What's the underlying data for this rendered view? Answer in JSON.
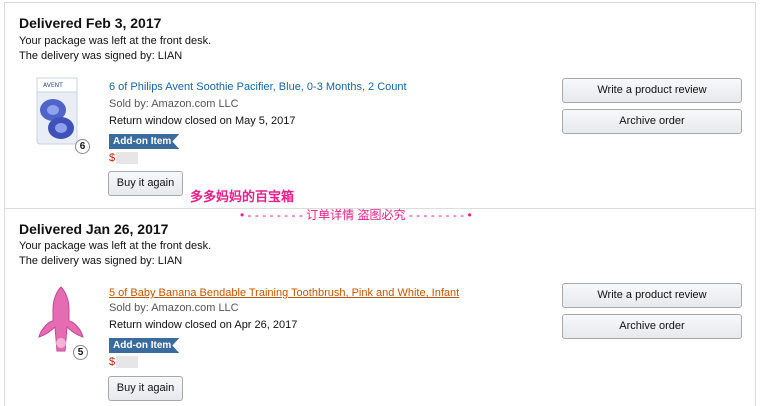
{
  "orders": [
    {
      "status_title": "Delivered Feb 3, 2017",
      "note_left": "Your package was left at the front desk.",
      "note_signed": "The delivery was signed by: LIAN",
      "item": {
        "title": "6 of Philips Avent Soothie Pacifier, Blue, 0-3 Months, 2 Count",
        "sold_by": "Sold by: Amazon.com LLC",
        "return_window": "Return window closed on May 5, 2017",
        "badge": "Add-on Item",
        "price_symbol": "$",
        "qty": "6"
      },
      "buy_again": "Buy it again",
      "write_review": "Write a product review",
      "archive": "Archive order"
    },
    {
      "status_title": "Delivered Jan 26, 2017",
      "note_left": "Your package was left at the front desk.",
      "note_signed": "The delivery was signed by: LIAN",
      "item": {
        "title": "5 of Baby Banana Bendable Training Toothbrush, Pink and White, Infant",
        "sold_by": "Sold by: Amazon.com LLC",
        "return_window": "Return window closed on Apr 26, 2017",
        "badge": "Add-on Item",
        "price_symbol": "$",
        "qty": "5"
      },
      "buy_again": "Buy it again",
      "write_review": "Write a product review",
      "archive": "Archive order"
    }
  ],
  "watermark": {
    "line1": "多多妈妈的百宝箱",
    "line2": "• - - - - - - - - 订单详情 盗图必究 - - - - - - - - •"
  },
  "colors": {
    "link_blue": "#1565a8",
    "link_orange": "#c45500",
    "addon_blue": "#3a6b9e",
    "price_red": "#b12704",
    "watermark_pink": "#e91e8c"
  }
}
